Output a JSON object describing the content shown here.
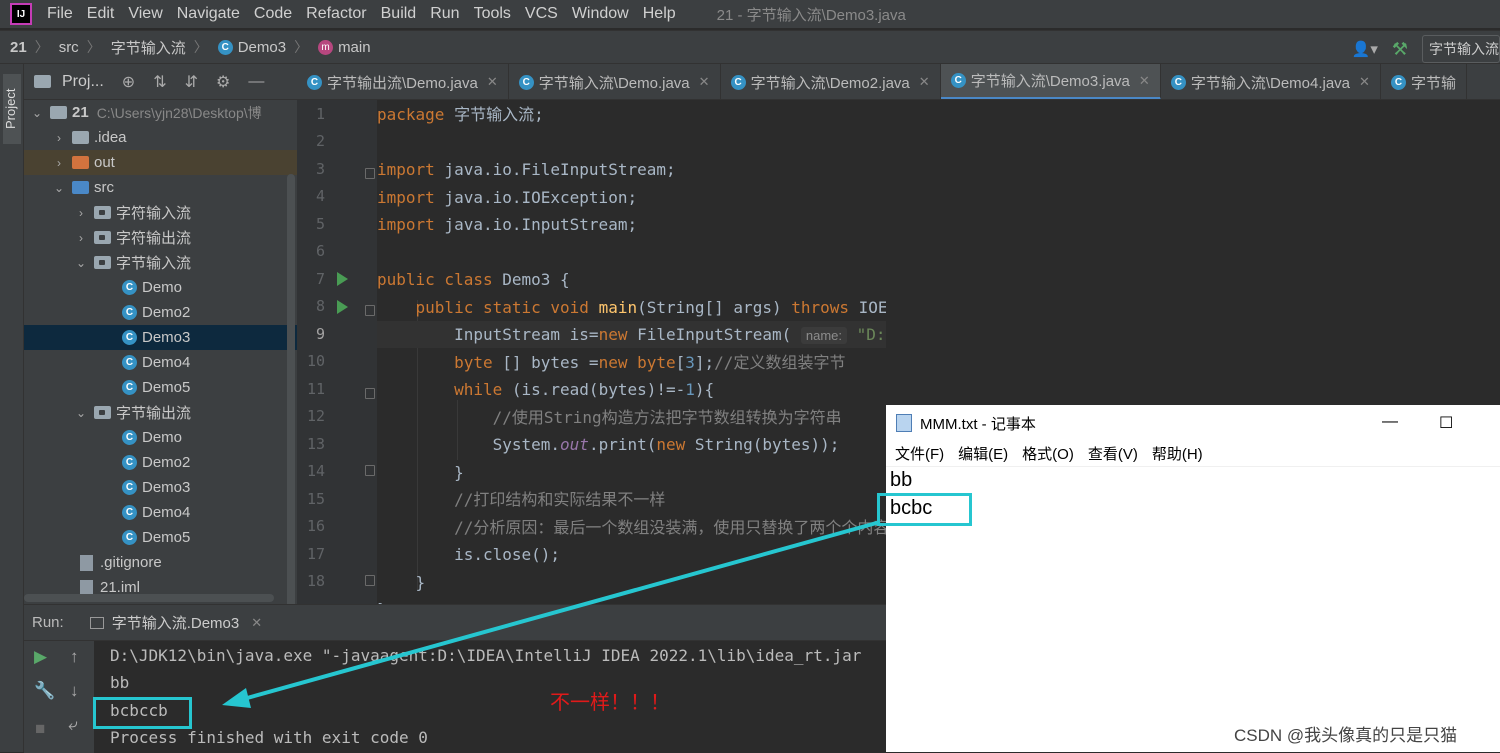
{
  "app": {
    "menu": [
      "File",
      "Edit",
      "View",
      "Navigate",
      "Code",
      "Refactor",
      "Build",
      "Run",
      "Tools",
      "VCS",
      "Window",
      "Help"
    ],
    "window_title": "21 - 字节输入流\\Demo3.java"
  },
  "breadcrumb": {
    "project": "21",
    "src": "src",
    "pkg": "字节输入流",
    "cls": "Demo3",
    "method": "main",
    "run_config": "字节输入流.Demo3"
  },
  "project_panel": {
    "title": "Proj...",
    "side_label": "Project",
    "tree": [
      {
        "label": "21",
        "path": "C:\\Users\\yjn28\\Desktop\\博"
      },
      {
        "label": ".idea"
      },
      {
        "label": "out"
      },
      {
        "label": "src"
      },
      {
        "label": "字符输入流"
      },
      {
        "label": "字符输出流"
      },
      {
        "label": "字节输入流"
      },
      {
        "label": "Demo"
      },
      {
        "label": "Demo2"
      },
      {
        "label": "Demo3"
      },
      {
        "label": "Demo4"
      },
      {
        "label": "Demo5"
      },
      {
        "label": "字节输出流"
      },
      {
        "label": "Demo"
      },
      {
        "label": "Demo2"
      },
      {
        "label": "Demo3"
      },
      {
        "label": "Demo4"
      },
      {
        "label": "Demo5"
      },
      {
        "label": ".gitignore"
      },
      {
        "label": "21.iml"
      }
    ]
  },
  "tabs": [
    "字节输出流\\Demo.java",
    "字节输入流\\Demo.java",
    "字节输入流\\Demo2.java",
    "字节输入流\\Demo3.java",
    "字节输入流\\Demo4.java",
    "字节输"
  ],
  "editor": {
    "line_numbers": [
      "1",
      "2",
      "3",
      "4",
      "5",
      "6",
      "7",
      "8",
      "9",
      "10",
      "11",
      "12",
      "13",
      "14",
      "15",
      "16",
      "17",
      "18"
    ],
    "comment_define": "//定义数组装字节",
    "comment_string": "//使用String构造方法把字节数组转换为字符串",
    "comment_result": "//打印结构和实际结果不一样",
    "comment_analysis": "//分析原因：最后一个数组没装满，使用只替换了两个个内容",
    "param_hint": "name:",
    "file_literal": "\"D:\\\\MMM.txt\""
  },
  "run": {
    "label": "Run:",
    "tab": "字节输入流.Demo3",
    "lines": [
      "D:\\JDK12\\bin\\java.exe \"-javaagent:D:\\IDEA\\IntelliJ IDEA 2022.1\\lib\\idea_rt.jar",
      "bb",
      "bcbccb",
      "Process finished with exit code 0"
    ]
  },
  "notepad": {
    "title": "MMM.txt - 记事本",
    "menu": [
      "文件(F)",
      "编辑(E)",
      "格式(O)",
      "查看(V)",
      "帮助(H)"
    ],
    "lines": [
      "bb",
      "bcbc"
    ]
  },
  "annotation": "不一样！！！",
  "watermark": "CSDN @我头像真的只是只猫",
  "colors": {
    "highlight_box": "#26c6d0",
    "annotation_red": "#e01a1a",
    "keyword": "#cc7832",
    "string": "#6a8759",
    "number": "#6897bb"
  }
}
